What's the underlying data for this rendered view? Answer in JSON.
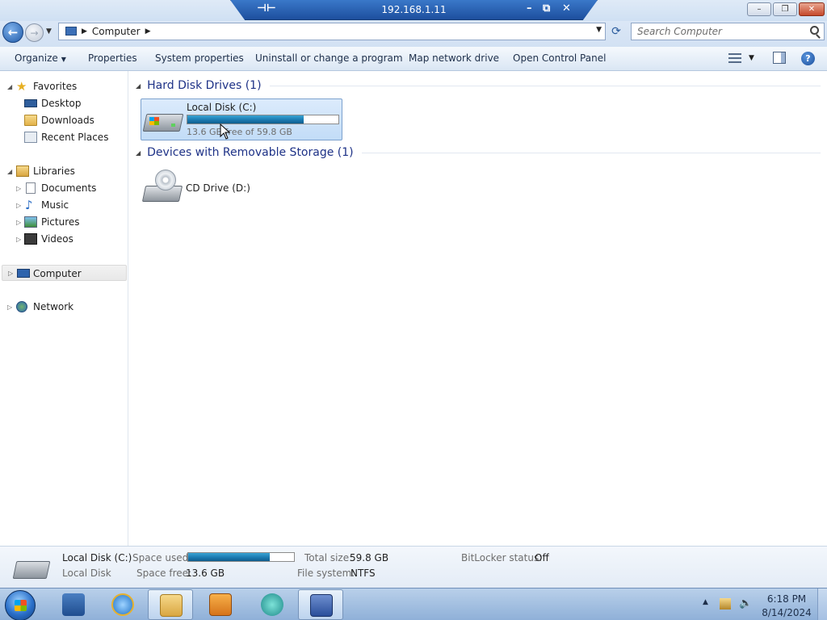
{
  "rdp": {
    "title": "192.168.1.11",
    "pin": "⊣⊢",
    "minimize": "–",
    "restore": "⧉",
    "close": "✕"
  },
  "window": {
    "minimize": "–",
    "maximize": "❐",
    "close": "✕"
  },
  "address": {
    "back": "←",
    "forward": "→",
    "location": "Computer",
    "refresh": "⟳"
  },
  "search": {
    "placeholder": "Search Computer"
  },
  "toolbar": {
    "organize": "Organize",
    "properties": "Properties",
    "system_properties": "System properties",
    "uninstall": "Uninstall or change a program",
    "map_drive": "Map network drive",
    "control_panel": "Open Control Panel",
    "help": "?"
  },
  "nav": {
    "favorites": "Favorites",
    "desktop": "Desktop",
    "downloads": "Downloads",
    "recent": "Recent Places",
    "libraries": "Libraries",
    "documents": "Documents",
    "music": "Music",
    "pictures": "Pictures",
    "videos": "Videos",
    "computer": "Computer",
    "network": "Network"
  },
  "groups": {
    "hard_disks": "Hard Disk Drives (1)",
    "removable": "Devices with Removable Storage (1)"
  },
  "drives": {
    "c": {
      "name": "Local Disk (C:)",
      "free_text": "13.6 GB free of 59.8 GB",
      "used_fraction": 0.77
    },
    "d": {
      "name": "CD Drive (D:)"
    }
  },
  "details": {
    "name": "Local Disk (C:)",
    "type": "Local Disk",
    "space_used_label": "Space used:",
    "space_free_label": "Space free:",
    "space_free": "13.6 GB",
    "total_size_label": "Total size:",
    "total_size": "59.8 GB",
    "file_system_label": "File system:",
    "file_system": "NTFS",
    "bitlocker_label": "BitLocker status:",
    "bitlocker": "Off",
    "used_fraction": 0.77
  },
  "taskbar": {
    "time": "6:18 PM",
    "date": "8/14/2024"
  },
  "colors": {
    "accent": "#1e3287",
    "selection": "#c2dcf7",
    "bar": "#1b7ab1"
  }
}
